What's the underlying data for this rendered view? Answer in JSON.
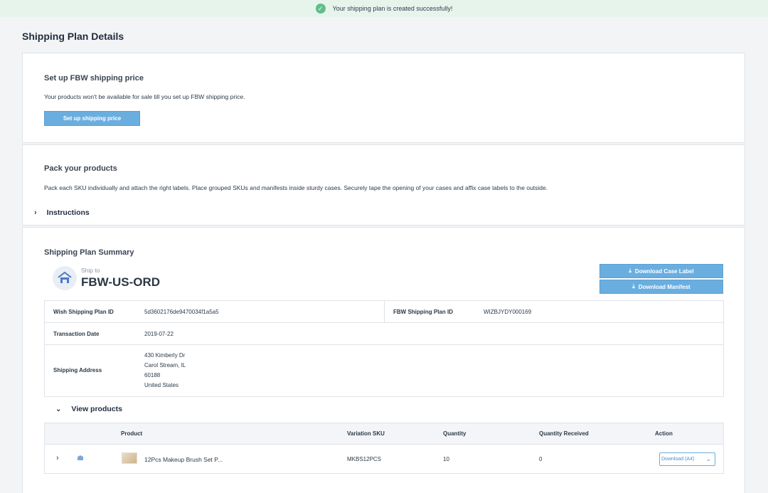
{
  "banner": {
    "message": "Your shipping plan is created successfully!",
    "icon": "check-circle-icon"
  },
  "page": {
    "title": "Shipping Plan Details"
  },
  "pricing": {
    "title": "Set up FBW shipping price",
    "description": "Your products won't be available for sale till you set up FBW shipping price.",
    "button_label": "Set up shipping price"
  },
  "pack": {
    "title": "Pack your products",
    "description": "Pack each SKU individually and attach the right labels. Place grouped SKUs and manifests inside sturdy cases. Securely tape the opening of your cases and affix case labels to the outside.",
    "instructions_label": "Instructions"
  },
  "summary": {
    "title": "Shipping Plan Summary",
    "ship_to_label": "Ship to",
    "ship_to_value": "FBW-US-ORD",
    "download_case_label": "Download Case Label",
    "download_manifest": "Download Manifest",
    "fields": {
      "wish_plan_id_label": "Wish Shipping Plan ID",
      "wish_plan_id": "5d3602176de9470034f1a5a5",
      "fbw_plan_id_label": "FBW Shipping Plan ID",
      "fbw_plan_id": "WIZBJYDY000169",
      "transaction_date_label": "Transaction Date",
      "transaction_date": "2019-07-22",
      "address_label": "Shipping Address",
      "address_line1": "430 Kimberly Dr",
      "address_line2": "Carol Stream, IL",
      "address_line3": "60188",
      "address_line4": "United States"
    }
  },
  "products": {
    "view_label": "View products",
    "columns": {
      "product": "Product",
      "sku": "Variation SKU",
      "quantity": "Quantity",
      "received": "Quantity Received",
      "action": "Action"
    },
    "rows": [
      {
        "name": "12Pcs Makeup Brush Set P...",
        "sku": "MKBS12PCS",
        "quantity": "10",
        "received": "0",
        "action": "Download (A4)"
      }
    ]
  },
  "colors": {
    "accent": "#6aaee0",
    "success": "#5fbf8a",
    "banner_bg": "#e6f4ec"
  }
}
